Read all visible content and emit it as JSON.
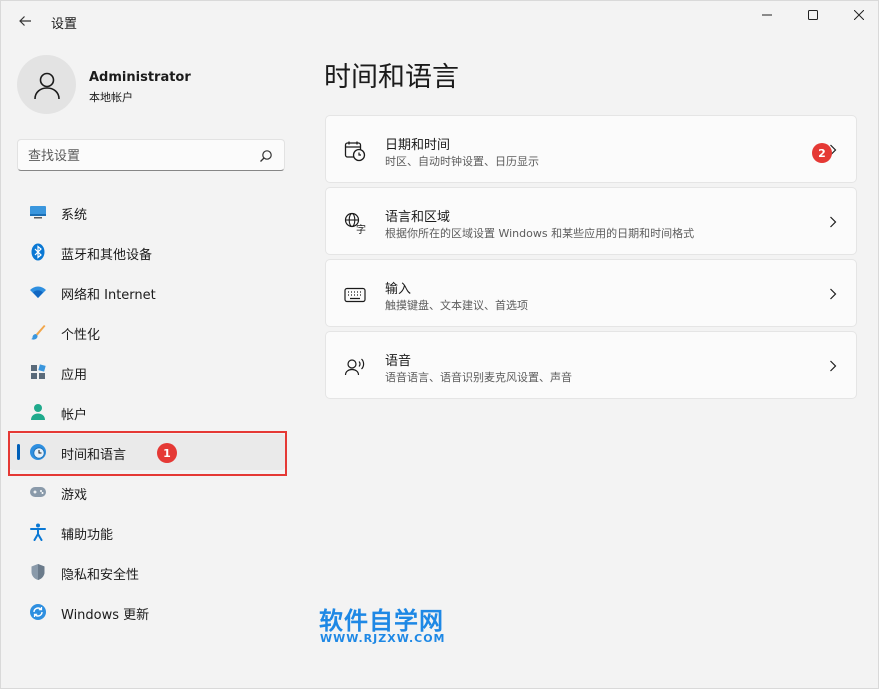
{
  "window": {
    "title": "设置"
  },
  "profile": {
    "name": "Administrator",
    "subtitle": "本地帐户"
  },
  "search": {
    "placeholder": "查找设置"
  },
  "sidebar": {
    "items": [
      {
        "label": "系统",
        "icon": "system-icon"
      },
      {
        "label": "蓝牙和其他设备",
        "icon": "bluetooth-icon"
      },
      {
        "label": "网络和 Internet",
        "icon": "wifi-icon"
      },
      {
        "label": "个性化",
        "icon": "brush-icon"
      },
      {
        "label": "应用",
        "icon": "apps-icon"
      },
      {
        "label": "帐户",
        "icon": "account-icon"
      },
      {
        "label": "时间和语言",
        "icon": "time-language-icon",
        "active": true
      },
      {
        "label": "游戏",
        "icon": "gamepad-icon"
      },
      {
        "label": "辅助功能",
        "icon": "accessibility-icon"
      },
      {
        "label": "隐私和安全性",
        "icon": "shield-icon"
      },
      {
        "label": "Windows 更新",
        "icon": "update-icon"
      }
    ]
  },
  "main": {
    "title": "时间和语言",
    "cards": [
      {
        "title": "日期和时间",
        "subtitle": "时区、自动时钟设置、日历显示",
        "icon": "calendar-clock-icon"
      },
      {
        "title": "语言和区域",
        "subtitle": "根据你所在的区域设置 Windows 和某些应用的日期和时间格式",
        "icon": "language-icon"
      },
      {
        "title": "输入",
        "subtitle": "触摸键盘、文本建议、首选项",
        "icon": "keyboard-icon"
      },
      {
        "title": "语音",
        "subtitle": "语音语言、语音识别麦克风设置、声音",
        "icon": "speech-icon"
      }
    ]
  },
  "annotations": {
    "badge1": "1",
    "badge2": "2"
  },
  "watermark": {
    "title": "软件自学网",
    "url": "WWW.RJZXW.COM"
  },
  "colors": {
    "accent": "#005fb8",
    "annotation": "#e53935",
    "watermark": "#1e88e5"
  }
}
